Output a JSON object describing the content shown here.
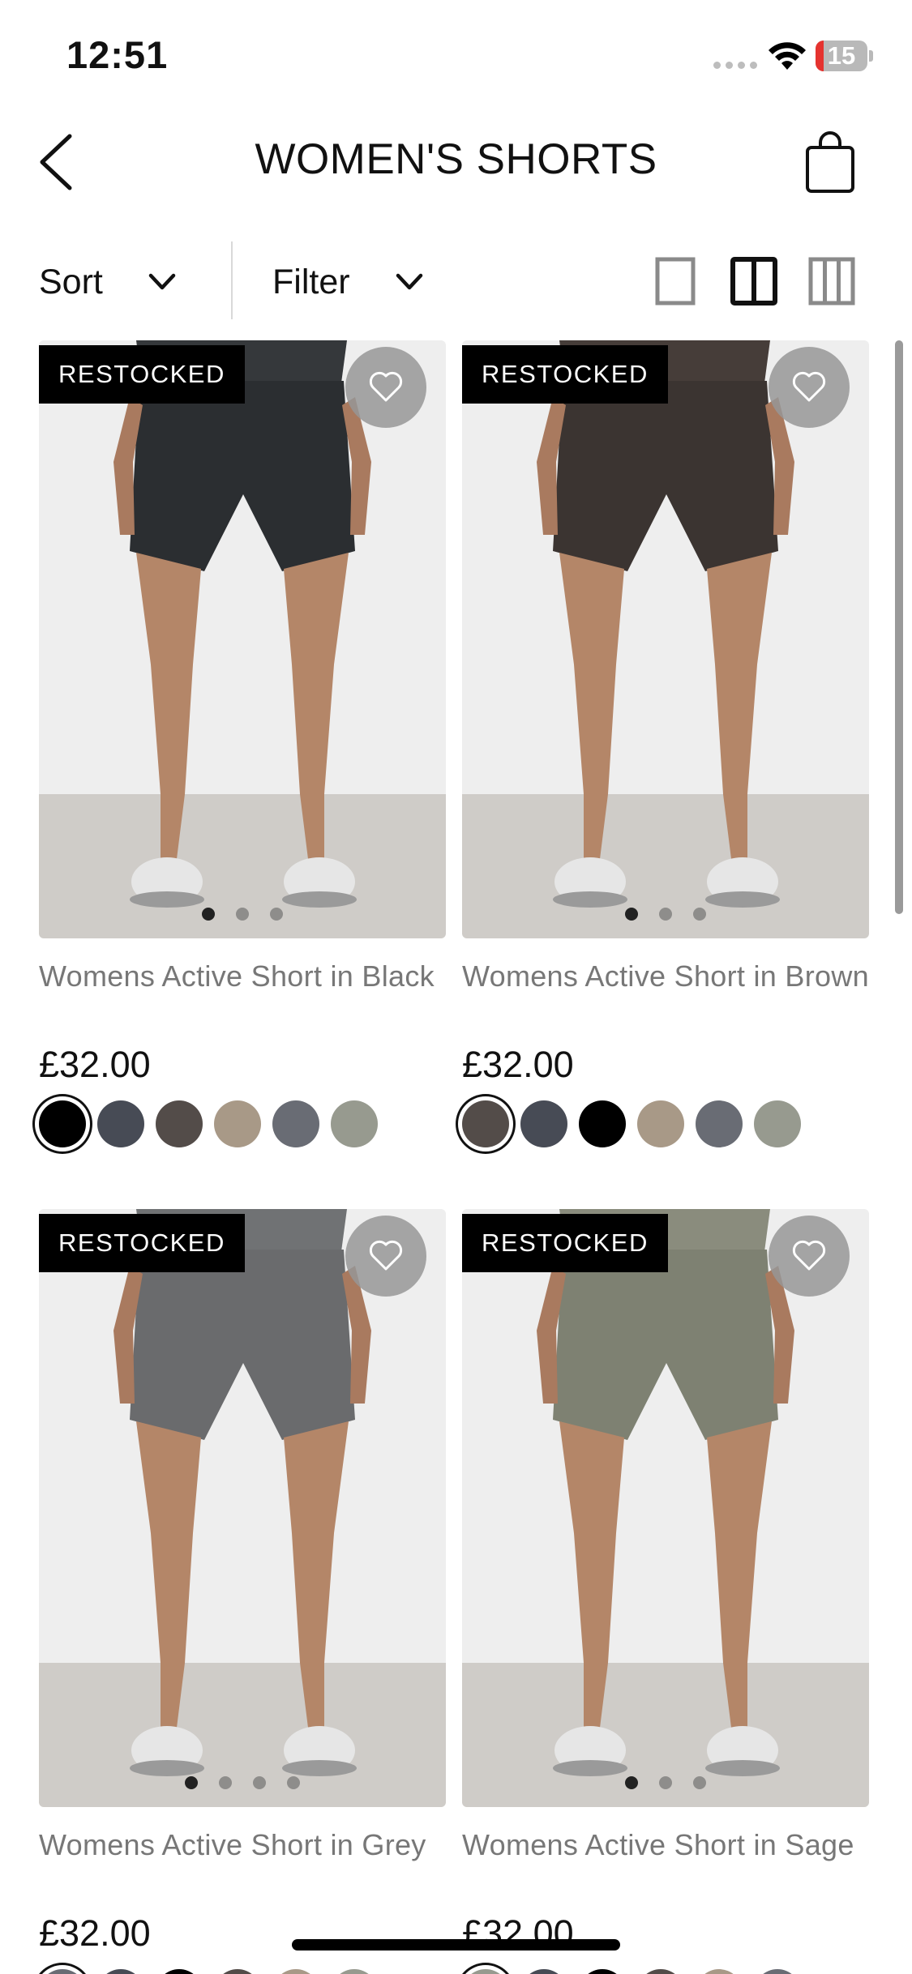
{
  "status_bar": {
    "time": "12:51",
    "battery": "15",
    "battery_fraction": 0.15,
    "battery_fill_color": "#e5332f",
    "icons": [
      "cellular-signal-icon",
      "wifi-icon",
      "battery-icon"
    ]
  },
  "header": {
    "title": "WOMEN'S SHORTS",
    "back_icon": "chevron-left-icon",
    "bag_icon": "shopping-bag-icon"
  },
  "toolbar": {
    "sort_label": "Sort",
    "filter_label": "Filter",
    "view_options": [
      "single-column-view-icon",
      "two-column-view-icon",
      "three-column-view-icon"
    ],
    "active_view": "two-column-view-icon"
  },
  "products": [
    {
      "badge": "RESTOCKED",
      "name": "Womens Active Short in Black",
      "price": "£32.00",
      "image_dots": 3,
      "active_dot": 1,
      "short_color": "#2b2e31",
      "top_color": "#35383b",
      "swatches": [
        "#000000",
        "#474b55",
        "#534c49",
        "#a89987",
        "#696c74",
        "#979a8f"
      ],
      "selected_swatch": 0
    },
    {
      "badge": "RESTOCKED",
      "name": "Womens Active Short in Brown",
      "price": "£32.00",
      "image_dots": 3,
      "active_dot": 1,
      "short_color": "#3b3431",
      "top_color": "#463d39",
      "swatches": [
        "#534c49",
        "#474b55",
        "#000000",
        "#a89987",
        "#696c74",
        "#979a8f"
      ],
      "selected_swatch": 0
    },
    {
      "badge": "RESTOCKED",
      "name": "Womens Active Short in Grey",
      "price": "£32.00",
      "image_dots": 4,
      "active_dot": 1,
      "short_color": "#6a6b6d",
      "top_color": "#707274",
      "swatches": [
        "#696c74",
        "#474b55",
        "#000000",
        "#534c49",
        "#a89987",
        "#979a8f"
      ],
      "selected_swatch": 0
    },
    {
      "badge": "RESTOCKED",
      "name": "Womens Active Short in Sage",
      "price": "£32.00",
      "image_dots": 3,
      "active_dot": 1,
      "short_color": "#7e8172",
      "top_color": "#8a8c7d",
      "swatches": [
        "#979a8f",
        "#474b55",
        "#000000",
        "#534c49",
        "#a89987",
        "#696c74"
      ],
      "selected_swatch": 0
    }
  ]
}
